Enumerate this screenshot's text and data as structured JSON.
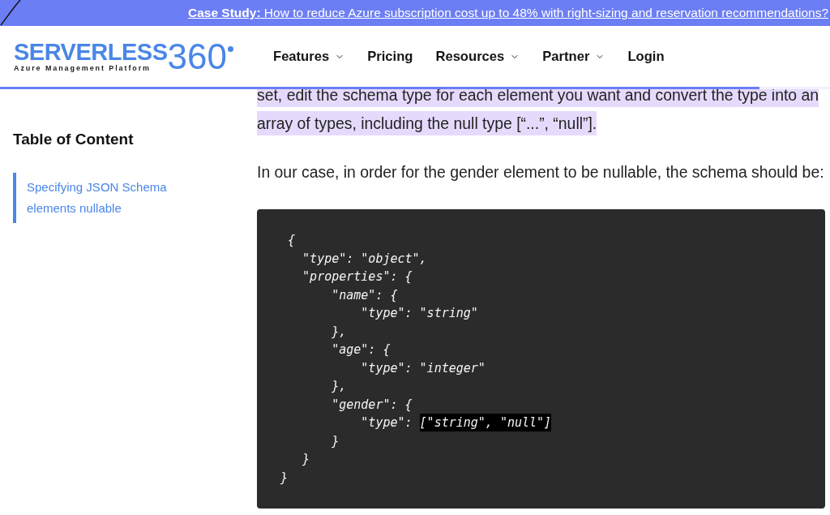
{
  "banner": {
    "text": "**Case Study:** How to reduce Azure subscription cost up to 48% with right-sizing and reservation recommendations?"
  },
  "header": {
    "logo": {
      "wordmark": "SERVERLESS",
      "number": "360",
      "tagline": "Azure Management Platform"
    },
    "nav": [
      {
        "label": "Features",
        "dropdown": true
      },
      {
        "label": "Pricing",
        "dropdown": false
      },
      {
        "label": "Resources",
        "dropdown": true
      },
      {
        "label": "Partner",
        "dropdown": true
      },
      {
        "label": "Login",
        "dropdown": false
      }
    ],
    "reading_progress": {
      "level": 0.915
    }
  },
  "table_of_content": {
    "title": "Table of Content",
    "items": [
      {
        "label": "Specifying JSON Schema elements nullable",
        "selected": true
      }
    ]
  },
  "article": {
    "paragraphs": [
      {
        "lines": [
          {
            "segments": [
              {
                "text": "set, edit the schema type for each element you want and convert the type into an",
                "highlighted": true
              }
            ]
          },
          {
            "segments": [
              {
                "text": "array of types, including the null type [“...”, “null”].",
                "highlighted": true
              }
            ]
          }
        ]
      },
      {
        "lines": [
          {
            "segments": [
              {
                "text": "In our case, in order for the gender element to be nullable, the schema should be:",
                "highlighted": false
              }
            ]
          }
        ]
      }
    ],
    "code_block": {
      "lines": [
        {
          "segments": [
            {
              "text": " {",
              "selected": false
            }
          ]
        },
        {
          "segments": [
            {
              "text": "   \"type\": \"object\",",
              "selected": false
            }
          ]
        },
        {
          "segments": [
            {
              "text": "   \"properties\": {",
              "selected": false
            }
          ]
        },
        {
          "segments": [
            {
              "text": "       \"name\": {",
              "selected": false
            }
          ]
        },
        {
          "segments": [
            {
              "text": "           \"type\": \"string\"",
              "selected": false
            }
          ]
        },
        {
          "segments": [
            {
              "text": "       },",
              "selected": false
            }
          ]
        },
        {
          "segments": [
            {
              "text": "       \"age\": {",
              "selected": false
            }
          ]
        },
        {
          "segments": [
            {
              "text": "           \"type\": \"integer\"",
              "selected": false
            }
          ]
        },
        {
          "segments": [
            {
              "text": "       },",
              "selected": false
            }
          ]
        },
        {
          "segments": [
            {
              "text": "       \"gender\": {",
              "selected": false
            }
          ]
        },
        {
          "segments": [
            {
              "text": "           \"type\": ",
              "selected": false
            },
            {
              "text": "[\"string\", \"null\"]",
              "selected": true
            }
          ]
        },
        {
          "segments": [
            {
              "text": "       }",
              "selected": false
            }
          ]
        },
        {
          "segments": [
            {
              "text": "   }",
              "selected": false
            }
          ]
        },
        {
          "segments": [
            {
              "text": "}",
              "selected": false
            }
          ]
        }
      ]
    }
  }
}
